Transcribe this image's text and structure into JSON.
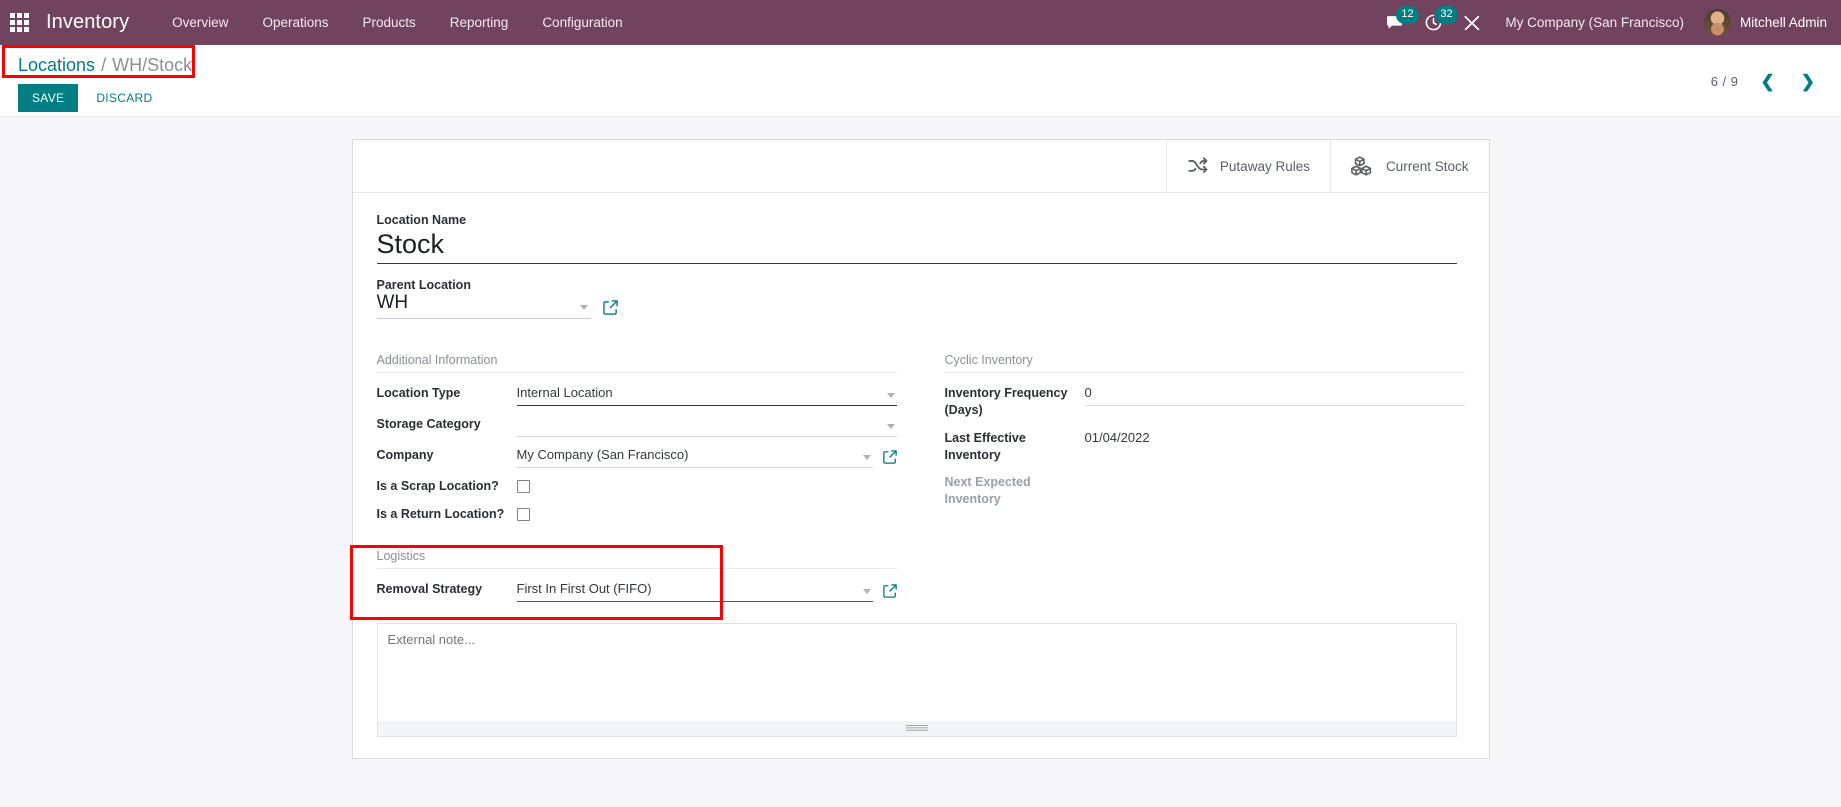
{
  "navbar": {
    "apps_icon": "apps-grid-icon",
    "brand": "Inventory",
    "menu": [
      {
        "label": "Overview"
      },
      {
        "label": "Operations"
      },
      {
        "label": "Products"
      },
      {
        "label": "Reporting"
      },
      {
        "label": "Configuration"
      }
    ],
    "messages": {
      "icon": "chat-bubble-icon",
      "count": "12"
    },
    "activities": {
      "icon": "clock-activity-icon",
      "count": "32"
    },
    "tools": {
      "icon": "wrench-tools-icon"
    },
    "company": "My Company (San Francisco)",
    "user": {
      "name": "Mitchell Admin",
      "avatar": "user-avatar"
    }
  },
  "control_panel": {
    "breadcrumb": {
      "root": "Locations",
      "separator": "/",
      "current": "WH/Stock"
    },
    "save_label": "SAVE",
    "discard_label": "DISCARD",
    "pager": {
      "count": "6 / 9",
      "prev_icon": "chevron-left-icon",
      "next_icon": "chevron-right-icon"
    }
  },
  "smart_buttons": [
    {
      "label": "Putaway Rules",
      "icon": "shuffle-icon"
    },
    {
      "label": "Current Stock",
      "icon": "boxes-icon"
    }
  ],
  "form": {
    "location_name": {
      "label": "Location Name",
      "value": "Stock"
    },
    "parent_location": {
      "label": "Parent Location",
      "value": "WH",
      "external_link_icon": "external-link-icon"
    },
    "additional_information": {
      "title": "Additional Information",
      "location_type": {
        "label": "Location Type",
        "value": "Internal Location"
      },
      "storage_category": {
        "label": "Storage Category",
        "value": ""
      },
      "company": {
        "label": "Company",
        "value": "My Company (San Francisco)",
        "external_link_icon": "external-link-icon"
      },
      "is_scrap_location": {
        "label": "Is a Scrap Location?",
        "checked": false
      },
      "is_return_location": {
        "label": "Is a Return Location?",
        "checked": false
      }
    },
    "cyclic_inventory": {
      "title": "Cyclic Inventory",
      "inventory_frequency": {
        "label": "Inventory Frequency (Days)",
        "value": "0"
      },
      "last_effective_inventory": {
        "label": "Last Effective Inventory",
        "value": "01/04/2022"
      },
      "next_expected_inventory": {
        "label": "Next Expected Inventory",
        "value": ""
      }
    },
    "logistics": {
      "title": "Logistics",
      "removal_strategy": {
        "label": "Removal Strategy",
        "value": "First In First Out (FIFO)",
        "external_link_icon": "external-link-icon"
      }
    },
    "notes": {
      "placeholder": "External note...",
      "value": ""
    }
  },
  "annotations": {
    "breadcrumb_highlight_color": "#ff0000",
    "logistics_highlight_color": "#ff0000"
  },
  "colors": {
    "navbar": "#71435f",
    "accent": "#017e84",
    "page_background": "#f7f7f9"
  }
}
